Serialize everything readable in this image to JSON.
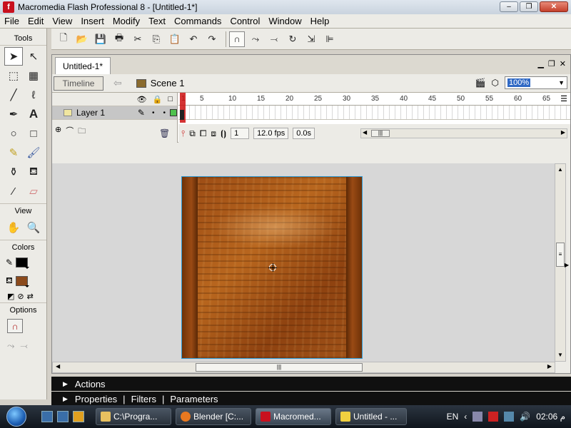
{
  "window": {
    "title": "Macromedia Flash Professional 8 - [Untitled-1*]",
    "app_icon": "f",
    "min_label": "–",
    "max_label": "❐",
    "close_label": "✕"
  },
  "menu": [
    "File",
    "Edit",
    "View",
    "Insert",
    "Modify",
    "Text",
    "Commands",
    "Control",
    "Window",
    "Help"
  ],
  "toolbar": {
    "icons": [
      "new-icon",
      "open-icon",
      "save-icon",
      "print-icon",
      "cut-icon",
      "copy-icon",
      "paste-icon",
      "undo-icon",
      "redo-icon",
      "snap-magnet-icon",
      "smooth-icon",
      "straighten-icon",
      "rotate-icon",
      "scale-icon",
      "align-icon"
    ]
  },
  "tools": {
    "header": "Tools",
    "view_label": "View",
    "colors_label": "Colors",
    "options_label": "Options",
    "stroke_color": "#000000",
    "fill_color": "#8b4a1c"
  },
  "document": {
    "tab_label": "Untitled-1*",
    "timeline_button": "Timeline",
    "scene_label": "Scene 1",
    "zoom_value": "100%"
  },
  "timeline": {
    "layer_name": "Layer 1",
    "ruler_numbers": [
      "1",
      "5",
      "10",
      "15",
      "20",
      "25",
      "30",
      "35",
      "40",
      "45",
      "50",
      "55",
      "60",
      "65"
    ],
    "current_frame": "1",
    "fps": "12.0 fps",
    "elapsed": "0.0s"
  },
  "panels": {
    "actions": "Actions",
    "properties": "Properties",
    "filters": "Filters",
    "parameters": "Parameters"
  },
  "taskbar": {
    "tasks": [
      "C:\\Progra...",
      "Blender [C:...",
      "Macromed...",
      "Untitled - ..."
    ],
    "language": "EN",
    "clock": "02:06 م"
  },
  "colors": {
    "selection_border": "#2e9bd6",
    "playhead": "#cc1111",
    "layer_color": "#4ec24e"
  }
}
